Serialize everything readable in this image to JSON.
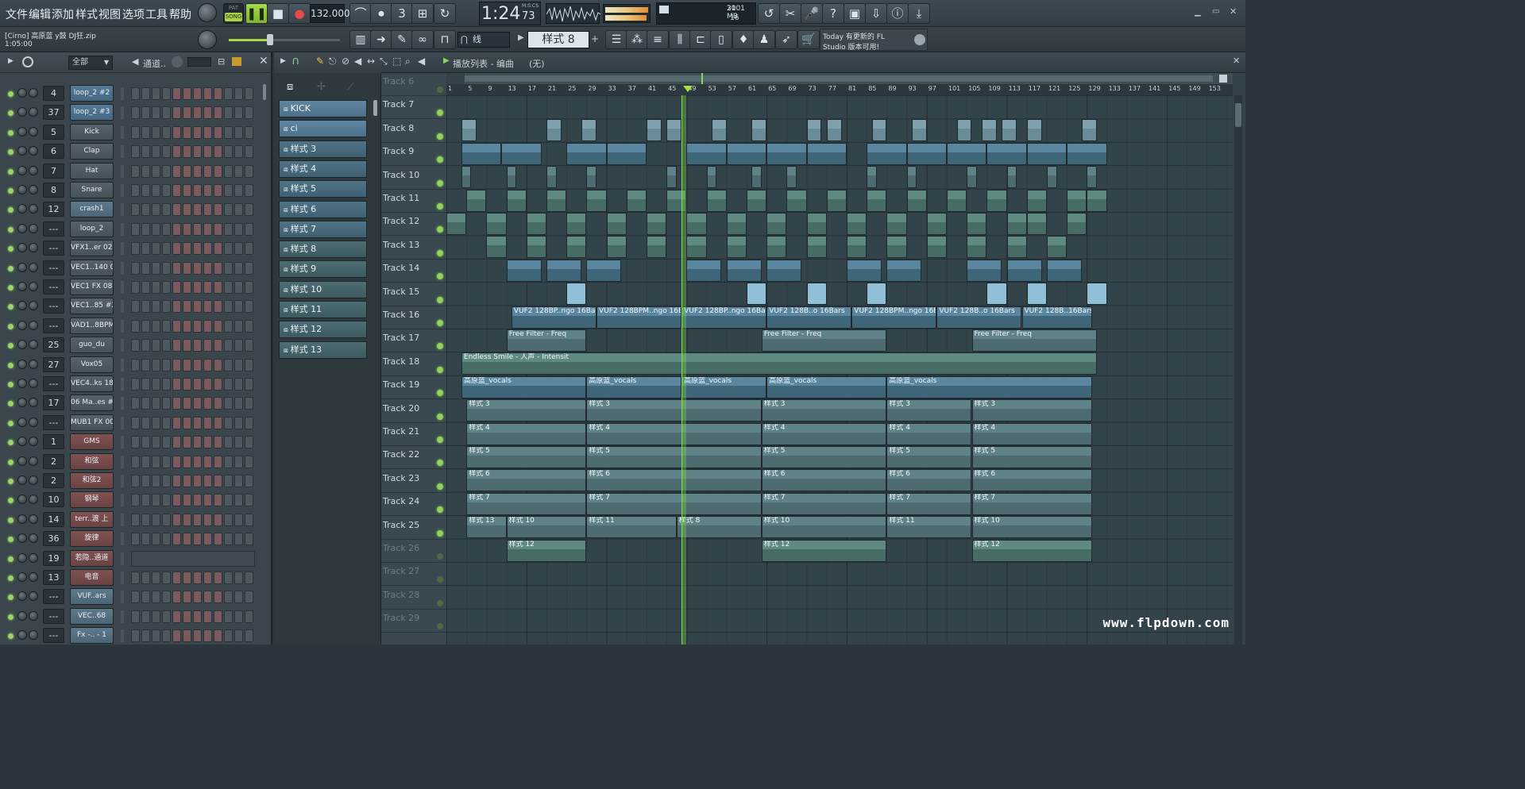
{
  "menu": [
    "文件",
    "编辑",
    "添加",
    "样式",
    "视图",
    "选项",
    "工具",
    "帮助"
  ],
  "transport": {
    "pat_label": "PAT",
    "song_label": "SONG",
    "tempo": "132.000",
    "time": "1:24",
    "time_sub": "73",
    "time_mode": "M:S:CS",
    "cpu": "21",
    "mem": "3001 MB",
    "poly": "16"
  },
  "project": {
    "name": "[Cirno] 高原蓝 y鼓 DJ狂.zip",
    "length": "1:05:00"
  },
  "snap_label": "线",
  "pattern_selector": "样式 8",
  "news": {
    "line1": "Today  有更新的 FL",
    "line2": "Studio 版本可用!"
  },
  "rack": {
    "filter": "全部",
    "title": "通道.."
  },
  "channels": [
    {
      "num": "4",
      "name": "loop_2 #2",
      "style": "sel"
    },
    {
      "num": "37",
      "name": "loop_2 #3",
      "style": "sel"
    },
    {
      "num": "5",
      "name": "Kick",
      "style": "gray"
    },
    {
      "num": "6",
      "name": "Clap",
      "style": "gray"
    },
    {
      "num": "7",
      "name": "Hat",
      "style": "gray"
    },
    {
      "num": "8",
      "name": "Snare",
      "style": "gray"
    },
    {
      "num": "12",
      "name": "crash1",
      "style": "blue"
    },
    {
      "num": "---",
      "name": "loop_2",
      "style": "gray"
    },
    {
      "num": "---",
      "name": "VFX1..er 029",
      "style": "gray"
    },
    {
      "num": "---",
      "name": "VEC1..140 04",
      "style": "gray"
    },
    {
      "num": "---",
      "name": "VEC1 FX 085",
      "style": "gray"
    },
    {
      "num": "---",
      "name": "VEC1..85 #2",
      "style": "gray"
    },
    {
      "num": "---",
      "name": "VAD1..8BPM",
      "style": "gray"
    },
    {
      "num": "25",
      "name": "guo_du",
      "style": "gray"
    },
    {
      "num": "27",
      "name": "Vox05",
      "style": "gray"
    },
    {
      "num": "---",
      "name": "VEC4..ks 18",
      "style": "gray"
    },
    {
      "num": "17",
      "name": "06 Ma..es #2",
      "style": "gray"
    },
    {
      "num": "---",
      "name": "MUB1 FX 007",
      "style": "gray"
    },
    {
      "num": "1",
      "name": "GMS",
      "style": "red"
    },
    {
      "num": "2",
      "name": "和弦",
      "style": "red"
    },
    {
      "num": "2",
      "name": "和弦2",
      "style": "red"
    },
    {
      "num": "10",
      "name": "钢琴",
      "style": "red"
    },
    {
      "num": "14",
      "name": "terr..渡 上",
      "style": "red"
    },
    {
      "num": "36",
      "name": "旋律",
      "style": "red"
    },
    {
      "num": "19",
      "name": "若隐..通道",
      "style": "red"
    },
    {
      "num": "13",
      "name": "电音",
      "style": "red"
    },
    {
      "num": "---",
      "name": "VUF..ars",
      "style": "blue"
    },
    {
      "num": "---",
      "name": "VEC..68",
      "style": "blue"
    },
    {
      "num": "---",
      "name": "Fx -.. - 1",
      "style": "blue"
    }
  ],
  "patterns": [
    "KICK",
    "ci",
    "样式 3",
    "样式 4",
    "样式 5",
    "样式 6",
    "样式 7",
    "样式 8",
    "样式 9",
    "样式 10",
    "样式 11",
    "样式 12",
    "样式 13"
  ],
  "playlist": {
    "title": "播放列表 - 编曲",
    "subtitle": "(无)",
    "tracks": [
      "Track 6",
      "Track 7",
      "Track 8",
      "Track 9",
      "Track 10",
      "Track 11",
      "Track 12",
      "Track 13",
      "Track 14",
      "Track 15",
      "Track 16",
      "Track 17",
      "Track 18",
      "Track 19",
      "Track 20",
      "Track 21",
      "Track 22",
      "Track 23",
      "Track 24",
      "Track 25",
      "Track 26",
      "Track 27",
      "Track 28",
      "Track 29"
    ],
    "ruler": [
      "1",
      "5",
      "9",
      "13",
      "17",
      "21",
      "25",
      "29",
      "33",
      "37",
      "41",
      "45",
      "49",
      "53",
      "57",
      "61",
      "65",
      "69",
      "73",
      "77",
      "81",
      "85",
      "89",
      "93",
      "97",
      "101",
      "105",
      "109",
      "113",
      "117",
      "121",
      "125",
      "129",
      "133",
      "137",
      "141",
      "145",
      "149",
      "153"
    ],
    "clip_labels": {
      "vuf1": "VUF2 128BP..ngo 16Bars",
      "vuf2": "VUF2 128BPM..ngo 16Bars",
      "vuf3": "VUF2 128B..o 16Bars",
      "vuf4": "VUF2 128B..16Bars",
      "filter": "Free Filter - Freq",
      "endless": "Endless Smile - 人声 - Intensit",
      "vocals": "高原蓝_vocals",
      "p3": "样式 3",
      "p4": "样式 4",
      "p5": "样式 5",
      "p6": "样式 6",
      "p7": "样式 7",
      "p8": "样式 8",
      "p10": "样式 10",
      "p11": "样式 11",
      "p12": "样式 12",
      "p13": "样式 13"
    }
  },
  "watermark": "www.flpdown.com"
}
